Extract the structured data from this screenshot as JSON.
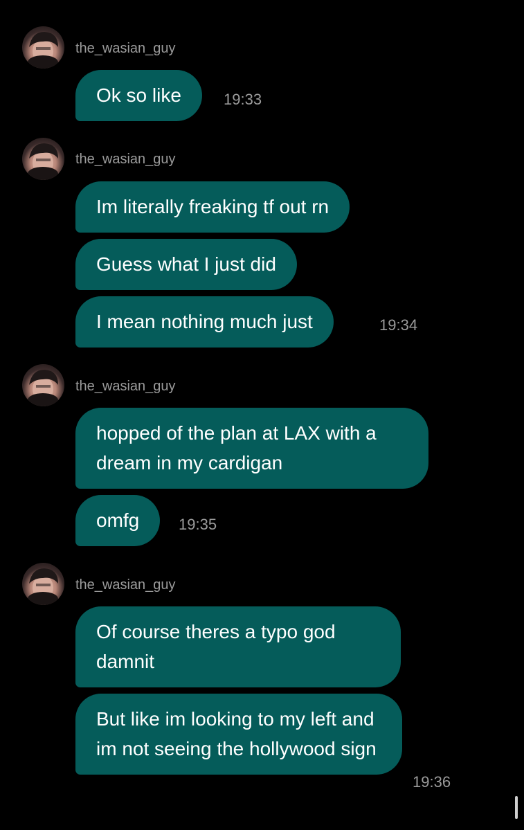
{
  "groups": [
    {
      "username": "the_wasian_guy",
      "messages": [
        {
          "text": "Ok so like"
        }
      ],
      "time": "19:33"
    },
    {
      "username": "the_wasian_guy",
      "messages": [
        {
          "text": "Im literally freaking tf out rn"
        },
        {
          "text": "Guess what I just did"
        },
        {
          "text": "I mean nothing much just"
        }
      ],
      "time": "19:34"
    },
    {
      "username": "the_wasian_guy",
      "messages": [
        {
          "text": "hopped of the plan at LAX with a dream in my cardigan"
        },
        {
          "text": "omfg"
        }
      ],
      "time": "19:35"
    },
    {
      "username": "the_wasian_guy",
      "messages": [
        {
          "text": "Of course theres a typo god damnit"
        },
        {
          "text": "But like im looking to my left and im not seeing the hollywood sign"
        }
      ],
      "time": "19:36"
    }
  ],
  "colors": {
    "background": "#000000",
    "bubble": "#055c5a",
    "bubble_text": "#ffffff",
    "meta_text": "#9b9b9b"
  },
  "icons": {
    "avatar": "profile-photo"
  }
}
